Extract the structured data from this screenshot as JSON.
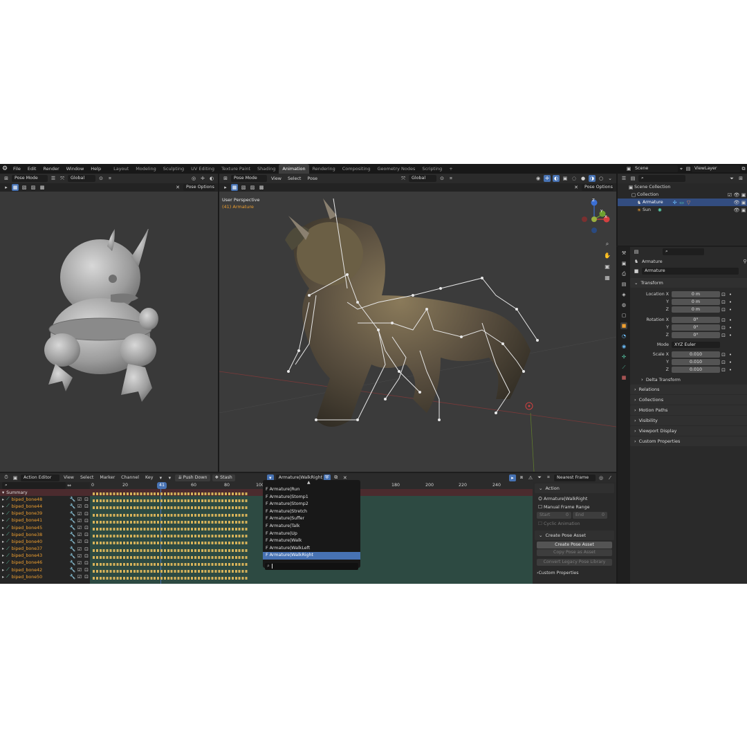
{
  "topbar": {
    "menus": [
      "File",
      "Edit",
      "Render",
      "Window",
      "Help"
    ],
    "workspaces": [
      "Layout",
      "Modeling",
      "Sculpting",
      "UV Editing",
      "Texture Paint",
      "Shading",
      "Animation",
      "Rendering",
      "Compositing",
      "Geometry Nodes",
      "Scripting",
      "+"
    ],
    "active_workspace": "Animation",
    "scene": "Scene",
    "view_layer": "ViewLayer"
  },
  "left_viewport": {
    "mode": "Pose Mode",
    "orientation": "Global",
    "pose_options": "Pose Options"
  },
  "main_viewport": {
    "mode": "Pose Mode",
    "menus": [
      "View",
      "Select",
      "Pose"
    ],
    "orientation": "Global",
    "pose_options": "Pose Options",
    "overlay_title": "User Perspective",
    "overlay_subtitle": "(41) Armature",
    "gizmo": {
      "z": "Z",
      "y": "Y",
      "x": "X"
    }
  },
  "outliner": {
    "items": [
      {
        "label": "Scene Collection"
      },
      {
        "label": "Collection"
      },
      {
        "label": "Armature"
      },
      {
        "label": "Sun"
      }
    ]
  },
  "properties": {
    "object_name": "Armature",
    "data_name": "Armature",
    "transform_title": "Transform",
    "location_label": "Location X",
    "location": [
      "0 m",
      "0 m",
      "0 m"
    ],
    "rotation_label": "Rotation X",
    "rotation": [
      "0°",
      "0°",
      "0°"
    ],
    "mode_label": "Mode",
    "mode_value": "XYZ Euler",
    "scale_label": "Scale X",
    "scale": [
      "0.010",
      "0.010",
      "0.010"
    ],
    "axis_y": "Y",
    "axis_z": "Z",
    "delta": "Delta Transform",
    "panels": [
      "Relations",
      "Collections",
      "Motion Paths",
      "Visibility",
      "Viewport Display",
      "Custom Properties"
    ]
  },
  "action_editor": {
    "mode": "Action Editor",
    "menus": [
      "View",
      "Select",
      "Marker",
      "Channel",
      "Key"
    ],
    "push_down": "Push Down",
    "stash": "Stash",
    "action": "Armature|WalkRight",
    "snap": "Nearest Frame",
    "current_frame": "41",
    "frame_ticks": [
      "0",
      "20",
      "40",
      "60",
      "80",
      "100",
      "180",
      "200",
      "220",
      "240"
    ],
    "summary": "Summary",
    "channels": [
      "biped_bone48",
      "biped_bone44",
      "biped_bone39",
      "biped_bone41",
      "biped_bone45",
      "biped_bone38",
      "biped_bone40",
      "biped_bone37",
      "biped_bone43",
      "biped_bone46",
      "biped_bone42",
      "biped_bone50"
    ],
    "dropdown": [
      "F Armature|Run",
      "F Armature|Stomp1",
      "F Armature|Stomp2",
      "F Armature|Stretch",
      "F Armature|Suffer",
      "F Armature|Talk",
      "F Armature|Up",
      "F Armature|Walk",
      "F Armature|WalkLeft",
      "F Armature|WalkRight"
    ],
    "dropdown_selected": "F Armature|WalkRight"
  },
  "sidebar": {
    "action_title": "Action",
    "action_name": "Armature|WalkRight",
    "manual_range": "Manual Frame Range",
    "start": "Start",
    "start_val": "0",
    "end": "End",
    "end_val": "0",
    "cyclic": "Cyclic Animation",
    "pose_asset_title": "Create Pose Asset",
    "create_pose": "Create Pose Asset",
    "copy_pose": "Copy Pose as Asset",
    "convert": "Convert Legacy Pose Library",
    "custom_props": "Custom Properties"
  },
  "colors": {
    "accent": "#4772b3",
    "bone_orange": "#f0a030",
    "keyframe": "#d6b25a"
  }
}
